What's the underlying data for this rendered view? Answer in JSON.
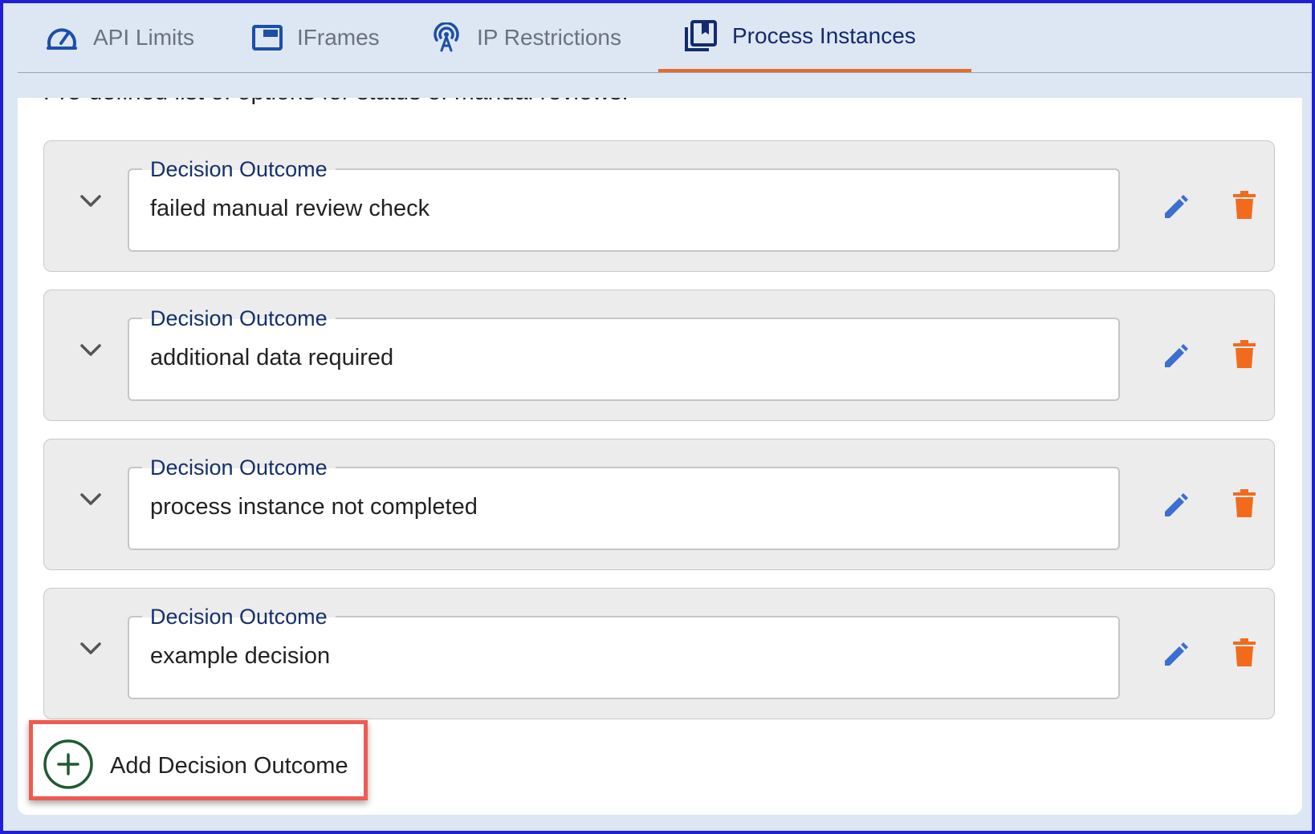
{
  "tabs": [
    {
      "label": "API Limits",
      "icon": "gauge-icon",
      "active": false
    },
    {
      "label": "IFrames",
      "icon": "window-icon",
      "active": false
    },
    {
      "label": "IP Restrictions",
      "icon": "antenna-icon",
      "active": false
    },
    {
      "label": "Process Instances",
      "icon": "library-books-icon",
      "active": true
    }
  ],
  "description": "Pre-defined list of options for status of manual reviews.",
  "outcomes": [
    {
      "label": "Decision Outcome",
      "value": "failed manual review check"
    },
    {
      "label": "Decision Outcome",
      "value": "additional data required"
    },
    {
      "label": "Decision Outcome",
      "value": "process instance not completed"
    },
    {
      "label": "Decision Outcome",
      "value": "example decision"
    }
  ],
  "add_button": {
    "label": "Add Decision Outcome"
  },
  "colors": {
    "accent_tab": "#e86a2a",
    "edit_icon": "#3b6fd1",
    "delete_icon": "#f26b1d",
    "add_icon": "#1f5a33",
    "highlight": "#f05a50"
  }
}
